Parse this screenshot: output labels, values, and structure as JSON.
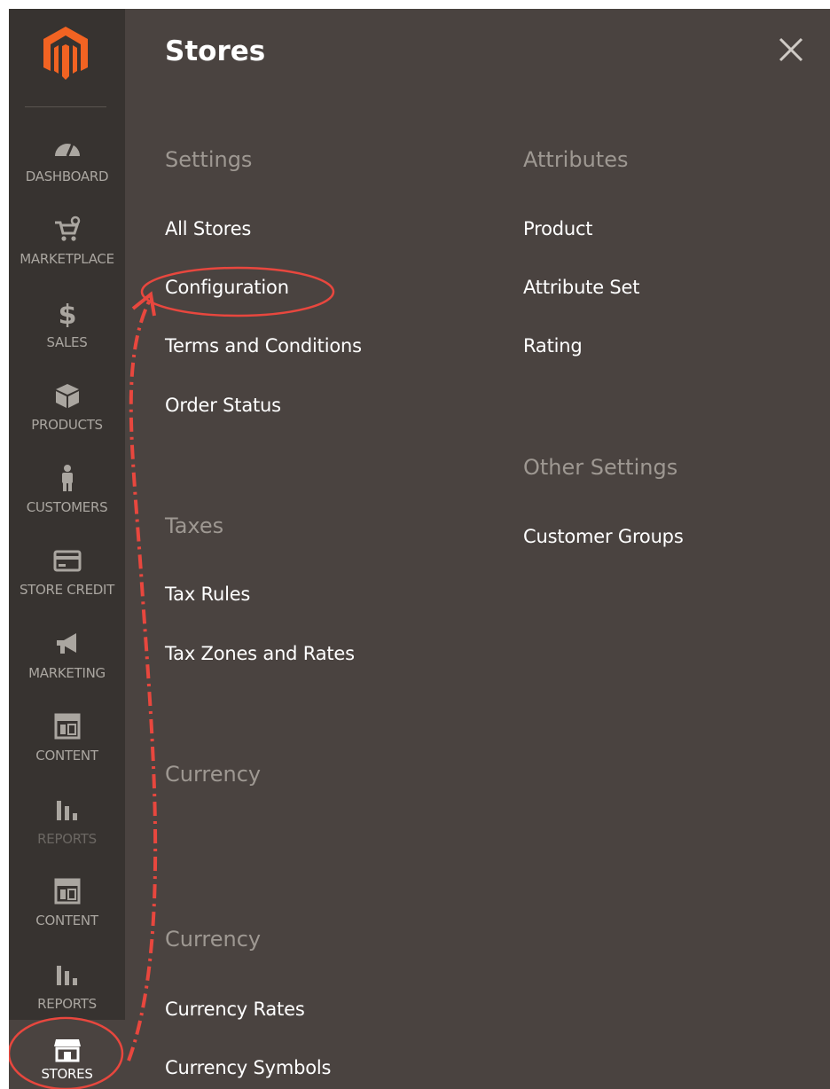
{
  "panel": {
    "title": "Stores"
  },
  "sidebar": {
    "items": [
      {
        "label": "DASHBOARD"
      },
      {
        "label": "MARKETPLACE"
      },
      {
        "label": "SALES"
      },
      {
        "label": "PRODUCTS"
      },
      {
        "label": "CUSTOMERS"
      },
      {
        "label": "STORE CREDIT"
      },
      {
        "label": "MARKETING"
      },
      {
        "label": "CONTENT"
      },
      {
        "label": "REPORTS"
      },
      {
        "label": "CONTENT"
      },
      {
        "label": "REPORTS"
      },
      {
        "label": "STORES"
      }
    ]
  },
  "sections": {
    "settings": {
      "heading": "Settings",
      "links": [
        "All Stores",
        "Configuration",
        "Terms and Conditions",
        "Order Status"
      ]
    },
    "taxes": {
      "heading": "Taxes",
      "links": [
        "Tax Rules",
        "Tax Zones and Rates"
      ]
    },
    "currency1": {
      "heading": "Currency"
    },
    "currency2": {
      "heading": "Currency",
      "links": [
        "Currency Rates",
        "Currency Symbols"
      ]
    },
    "attributes": {
      "heading": "Attributes",
      "links": [
        "Product",
        "Attribute Set",
        "Rating"
      ]
    },
    "other": {
      "heading": "Other Settings",
      "links": [
        "Customer Groups"
      ]
    }
  },
  "icons": {
    "logo": "magento-logo",
    "close": "close-icon"
  },
  "colors": {
    "brand": "#f26322",
    "annotation": "#e8473e",
    "sidebar_bg": "#373330",
    "panel_bg": "#4a4340"
  }
}
